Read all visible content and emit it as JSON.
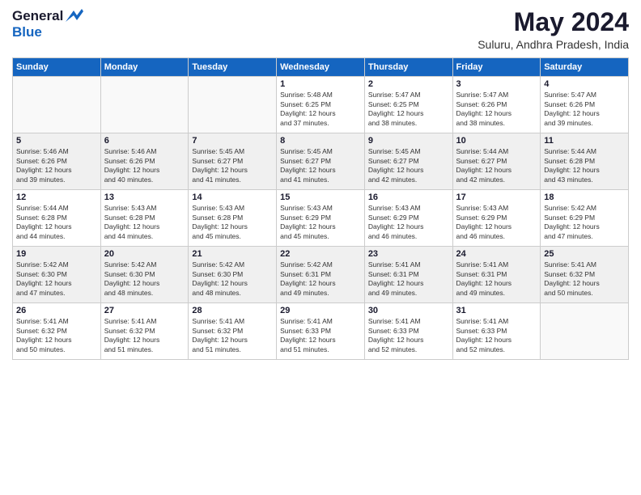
{
  "header": {
    "logo_general": "General",
    "logo_blue": "Blue",
    "title": "May 2024",
    "subtitle": "Suluru, Andhra Pradesh, India"
  },
  "days_of_week": [
    "Sunday",
    "Monday",
    "Tuesday",
    "Wednesday",
    "Thursday",
    "Friday",
    "Saturday"
  ],
  "weeks": [
    [
      {
        "day": "",
        "info": ""
      },
      {
        "day": "",
        "info": ""
      },
      {
        "day": "",
        "info": ""
      },
      {
        "day": "1",
        "info": "Sunrise: 5:48 AM\nSunset: 6:25 PM\nDaylight: 12 hours\nand 37 minutes."
      },
      {
        "day": "2",
        "info": "Sunrise: 5:47 AM\nSunset: 6:25 PM\nDaylight: 12 hours\nand 38 minutes."
      },
      {
        "day": "3",
        "info": "Sunrise: 5:47 AM\nSunset: 6:26 PM\nDaylight: 12 hours\nand 38 minutes."
      },
      {
        "day": "4",
        "info": "Sunrise: 5:47 AM\nSunset: 6:26 PM\nDaylight: 12 hours\nand 39 minutes."
      }
    ],
    [
      {
        "day": "5",
        "info": "Sunrise: 5:46 AM\nSunset: 6:26 PM\nDaylight: 12 hours\nand 39 minutes."
      },
      {
        "day": "6",
        "info": "Sunrise: 5:46 AM\nSunset: 6:26 PM\nDaylight: 12 hours\nand 40 minutes."
      },
      {
        "day": "7",
        "info": "Sunrise: 5:45 AM\nSunset: 6:27 PM\nDaylight: 12 hours\nand 41 minutes."
      },
      {
        "day": "8",
        "info": "Sunrise: 5:45 AM\nSunset: 6:27 PM\nDaylight: 12 hours\nand 41 minutes."
      },
      {
        "day": "9",
        "info": "Sunrise: 5:45 AM\nSunset: 6:27 PM\nDaylight: 12 hours\nand 42 minutes."
      },
      {
        "day": "10",
        "info": "Sunrise: 5:44 AM\nSunset: 6:27 PM\nDaylight: 12 hours\nand 42 minutes."
      },
      {
        "day": "11",
        "info": "Sunrise: 5:44 AM\nSunset: 6:28 PM\nDaylight: 12 hours\nand 43 minutes."
      }
    ],
    [
      {
        "day": "12",
        "info": "Sunrise: 5:44 AM\nSunset: 6:28 PM\nDaylight: 12 hours\nand 44 minutes."
      },
      {
        "day": "13",
        "info": "Sunrise: 5:43 AM\nSunset: 6:28 PM\nDaylight: 12 hours\nand 44 minutes."
      },
      {
        "day": "14",
        "info": "Sunrise: 5:43 AM\nSunset: 6:28 PM\nDaylight: 12 hours\nand 45 minutes."
      },
      {
        "day": "15",
        "info": "Sunrise: 5:43 AM\nSunset: 6:29 PM\nDaylight: 12 hours\nand 45 minutes."
      },
      {
        "day": "16",
        "info": "Sunrise: 5:43 AM\nSunset: 6:29 PM\nDaylight: 12 hours\nand 46 minutes."
      },
      {
        "day": "17",
        "info": "Sunrise: 5:43 AM\nSunset: 6:29 PM\nDaylight: 12 hours\nand 46 minutes."
      },
      {
        "day": "18",
        "info": "Sunrise: 5:42 AM\nSunset: 6:29 PM\nDaylight: 12 hours\nand 47 minutes."
      }
    ],
    [
      {
        "day": "19",
        "info": "Sunrise: 5:42 AM\nSunset: 6:30 PM\nDaylight: 12 hours\nand 47 minutes."
      },
      {
        "day": "20",
        "info": "Sunrise: 5:42 AM\nSunset: 6:30 PM\nDaylight: 12 hours\nand 48 minutes."
      },
      {
        "day": "21",
        "info": "Sunrise: 5:42 AM\nSunset: 6:30 PM\nDaylight: 12 hours\nand 48 minutes."
      },
      {
        "day": "22",
        "info": "Sunrise: 5:42 AM\nSunset: 6:31 PM\nDaylight: 12 hours\nand 49 minutes."
      },
      {
        "day": "23",
        "info": "Sunrise: 5:41 AM\nSunset: 6:31 PM\nDaylight: 12 hours\nand 49 minutes."
      },
      {
        "day": "24",
        "info": "Sunrise: 5:41 AM\nSunset: 6:31 PM\nDaylight: 12 hours\nand 49 minutes."
      },
      {
        "day": "25",
        "info": "Sunrise: 5:41 AM\nSunset: 6:32 PM\nDaylight: 12 hours\nand 50 minutes."
      }
    ],
    [
      {
        "day": "26",
        "info": "Sunrise: 5:41 AM\nSunset: 6:32 PM\nDaylight: 12 hours\nand 50 minutes."
      },
      {
        "day": "27",
        "info": "Sunrise: 5:41 AM\nSunset: 6:32 PM\nDaylight: 12 hours\nand 51 minutes."
      },
      {
        "day": "28",
        "info": "Sunrise: 5:41 AM\nSunset: 6:32 PM\nDaylight: 12 hours\nand 51 minutes."
      },
      {
        "day": "29",
        "info": "Sunrise: 5:41 AM\nSunset: 6:33 PM\nDaylight: 12 hours\nand 51 minutes."
      },
      {
        "day": "30",
        "info": "Sunrise: 5:41 AM\nSunset: 6:33 PM\nDaylight: 12 hours\nand 52 minutes."
      },
      {
        "day": "31",
        "info": "Sunrise: 5:41 AM\nSunset: 6:33 PM\nDaylight: 12 hours\nand 52 minutes."
      },
      {
        "day": "",
        "info": ""
      }
    ]
  ]
}
